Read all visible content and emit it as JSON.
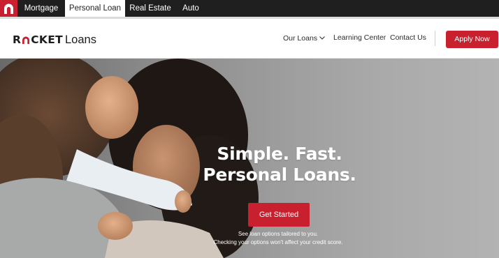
{
  "topbar": {
    "tabs": [
      {
        "label": "Mortgage",
        "active": false
      },
      {
        "label": "Personal Loan",
        "active": true
      },
      {
        "label": "Real Estate",
        "active": false
      },
      {
        "label": "Auto",
        "active": false
      }
    ]
  },
  "header": {
    "logo_word_1": "R",
    "logo_word_2": "CKET",
    "logo_word_3": "Loans",
    "nav": {
      "our_loans": "Our Loans",
      "learning_center": "Learning Center",
      "contact_us": "Contact Us"
    },
    "apply_label": "Apply Now"
  },
  "hero": {
    "title_line_1": "Simple. Fast.",
    "title_line_2": "Personal Loans.",
    "cta_label": "Get Started",
    "fine_print_1": "See loan options tailored to you.",
    "fine_print_2": "Checking your options won't affect your credit score."
  },
  "colors": {
    "brand_red": "#c8202f",
    "topbar_dark": "#1f1f1f"
  },
  "icons": [
    "rocket-logo-icon",
    "chevron-down-icon"
  ]
}
